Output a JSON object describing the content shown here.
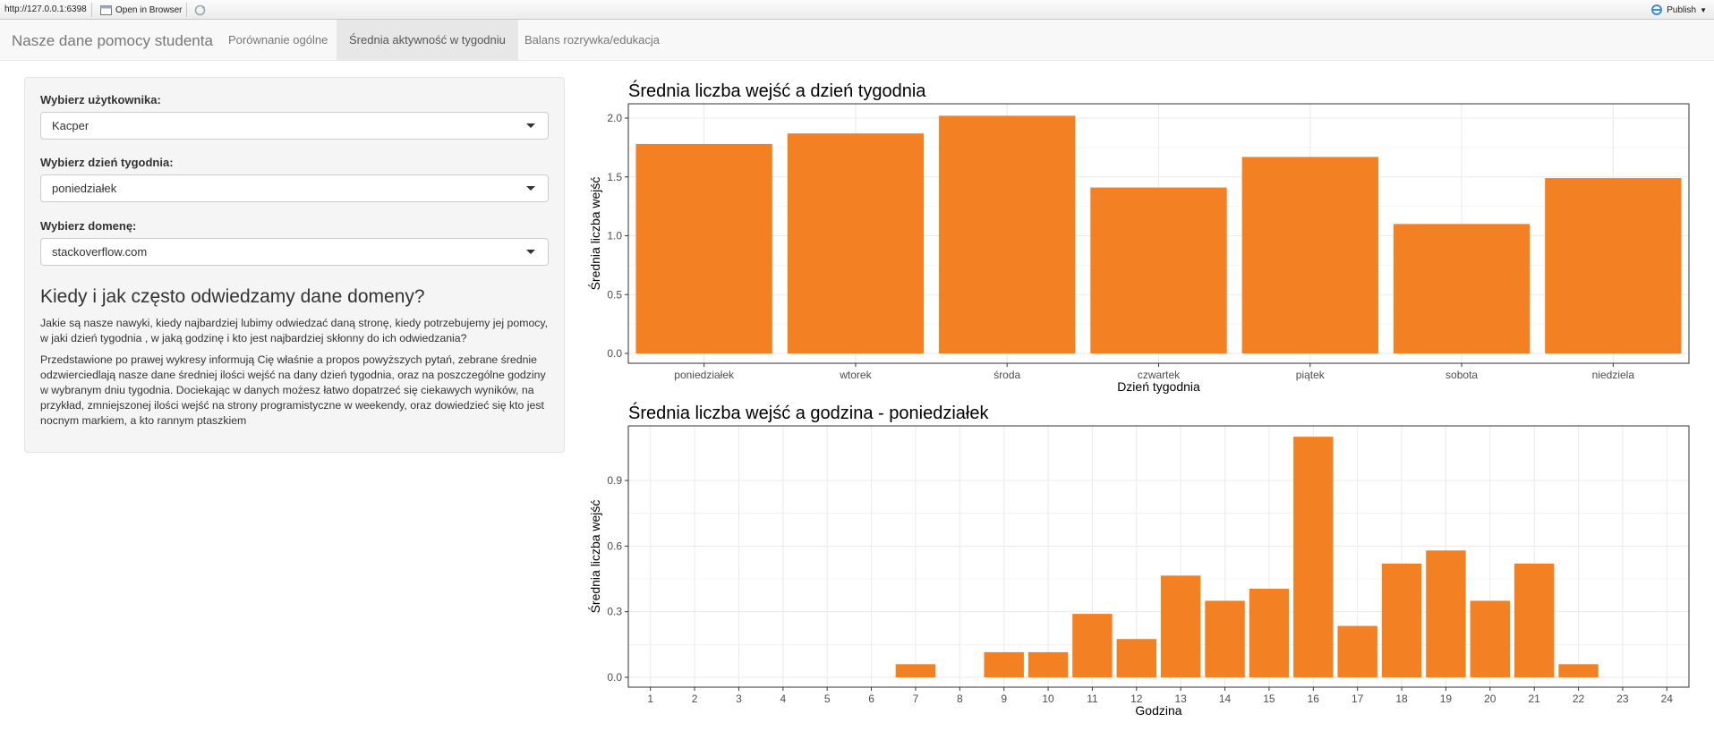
{
  "viewer": {
    "url": "http://127.0.0.1:6398",
    "open_in_browser": "Open in Browser",
    "publish": "Publish"
  },
  "navbar": {
    "brand": "Nasze dane pomocy studenta",
    "tabs": [
      {
        "label": "Porównanie ogólne",
        "active": false
      },
      {
        "label": "Średnia aktywność w tygodniu",
        "active": true
      },
      {
        "label": "Balans rozrywka/edukacja",
        "active": false
      }
    ]
  },
  "sidebar": {
    "user_label": "Wybierz użytkownika:",
    "user_value": "Kacper",
    "day_label": "Wybierz dzień tygodnia:",
    "day_value": "poniedziałek",
    "domain_label": "Wybierz domenę:",
    "domain_value": "stackoverflow.com",
    "heading": "Kiedy i jak często odwiedzamy dane domeny?",
    "paragraph1": "Jakie są nasze nawyki, kiedy najbardziej lubimy odwiedzać daną stronę, kiedy potrzebujemy jej pomocy, w jaki dzień tygodnia , w jaką godzinę i kto jest najbardziej skłonny do ich odwiedzania?",
    "paragraph2": "Przedstawione po prawej wykresy informują Cię właśnie a propos powyższych pytań, zebrane średnie odzwierciedlają nasze dane średniej ilości wejść na dany dzień tygodnia, oraz na poszczególne godziny w wybranym dniu tygodnia. Dociekając w danych możesz łatwo dopatrzeć się ciekawych wyników, na przykład, zmniejszonej ilości wejść na strony programistyczne w weekendy, oraz dowiedzieć się kto jest nocnym markiem, a kto rannym ptaszkiem"
  },
  "colors": {
    "bar": "#F48024",
    "panel_bg": "#ebebeb",
    "grid": "#ebebeb"
  },
  "chart_data": [
    {
      "type": "bar",
      "title": "Średnia liczba wejść a dzień tygodnia",
      "xlabel": "Dzień tygodnia",
      "ylabel": "Średnia liczba wejść",
      "categories": [
        "poniedziałek",
        "wtorek",
        "środa",
        "czwartek",
        "piątek",
        "sobota",
        "niedziela"
      ],
      "values": [
        1.78,
        1.87,
        2.02,
        1.41,
        1.67,
        1.1,
        1.49
      ],
      "ylim": [
        0,
        2.0
      ],
      "yticks": [
        "0.0",
        "0.5",
        "1.0",
        "1.5",
        "2.0"
      ],
      "grid": true
    },
    {
      "type": "bar",
      "title": "Średnia liczba wejść a godzina -  poniedziałek",
      "xlabel": "Godzina",
      "ylabel": "Średnia liczba wejść",
      "categories": [
        "1",
        "2",
        "3",
        "4",
        "5",
        "6",
        "7",
        "8",
        "9",
        "10",
        "11",
        "12",
        "13",
        "14",
        "15",
        "16",
        "17",
        "18",
        "19",
        "20",
        "21",
        "22",
        "23",
        "24"
      ],
      "values": [
        0,
        0,
        0,
        0,
        0,
        0,
        0.06,
        0,
        0.115,
        0.115,
        0.29,
        0.175,
        0.465,
        0.35,
        0.405,
        1.1,
        0.235,
        0.52,
        0.58,
        0.35,
        0.52,
        0.06,
        0,
        0
      ],
      "ylim": [
        0,
        0.9
      ],
      "yticks": [
        "0.0",
        "0.3",
        "0.6",
        "0.9"
      ],
      "grid": true
    }
  ]
}
